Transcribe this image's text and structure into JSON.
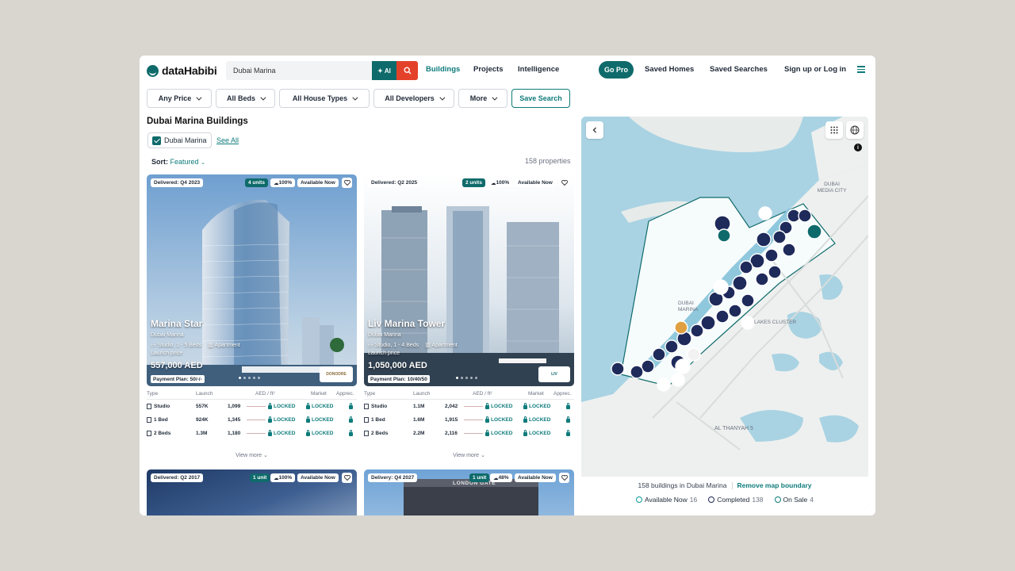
{
  "header": {
    "logo_text": "dataHabibi",
    "search_value": "Dubai Marina",
    "ai_label": "AI",
    "nav": [
      "Buildings",
      "Projects",
      "Intelligence"
    ],
    "go_pro": "Go Pro",
    "saved_homes": "Saved Homes",
    "saved_searches": "Saved Searches",
    "signup": "Sign up or Log in"
  },
  "filters": {
    "price": "Any Price",
    "beds": "All Beds",
    "house_types": "All House Types",
    "developers": "All Developers",
    "more": "More",
    "save_search": "Save Search"
  },
  "list": {
    "title": "Dubai Marina Buildings",
    "chip_label": "Dubai Marina",
    "see_all": "See All",
    "sort_label": "Sort:",
    "sort_value": "Featured",
    "count": "158 properties",
    "table_headers": [
      "Type",
      "Launch",
      "AED / ft²",
      "Market",
      "Apprec."
    ],
    "locked": "LOCKED",
    "view_more": "View more"
  },
  "cards": [
    {
      "delivered": "Delivered: Q4 2023",
      "units": "4 units",
      "percent": "100%",
      "availability": "Available Now",
      "name": "Marina Star",
      "area": "Dubai Marina",
      "beds": "Studio, 1 - 5 Beds",
      "type": "Apartment",
      "launch_label": "Launch price",
      "price": "557,000 AED",
      "plan": "Payment Plan: 50/-/-",
      "developer": "DONODRE",
      "rows": [
        {
          "type": "Studio",
          "launch": "557K",
          "aed": "1,099"
        },
        {
          "type": "1 Bed",
          "launch": "924K",
          "aed": "1,345"
        },
        {
          "type": "2 Beds",
          "launch": "1.3M",
          "aed": "1,180"
        }
      ]
    },
    {
      "delivered": "Delivered: Q2 2025",
      "units": "2 units",
      "percent": "100%",
      "availability": "Available Now",
      "name": "Liv Marina Tower",
      "area": "Dubai Marina",
      "beds": "Studio, 1 - 4 Beds",
      "type": "Apartment",
      "launch_label": "Launch price",
      "price": "1,050,000 AED",
      "plan": "Payment Plan: 10/40/50",
      "developer": "LIV",
      "rows": [
        {
          "type": "Studio",
          "launch": "1.1M",
          "aed": "2,042"
        },
        {
          "type": "1 Bed",
          "launch": "1.6M",
          "aed": "1,915"
        },
        {
          "type": "2 Beds",
          "launch": "2.2M",
          "aed": "2,116"
        }
      ]
    },
    {
      "delivered": "Delivered: Q2 2017",
      "units": "1 unit",
      "percent": "100%",
      "availability": "Available Now"
    },
    {
      "delivered": "Delivery: Q4 2027",
      "units": "1 unit",
      "percent": "48%",
      "availability": "Available Now",
      "sign": "LONDON GATE"
    }
  ],
  "map": {
    "labels": [
      "DUBAI MEDIA CITY",
      "DUBAI MARINA",
      "AL THANYAH 5",
      "LAKES CLUSTER"
    ],
    "footer_count": "158 buildings in Dubai Marina",
    "remove_boundary": "Remove map boundary",
    "legend": [
      {
        "label": "Available Now",
        "count": "16",
        "color": "#0f9b9b"
      },
      {
        "label": "Completed",
        "count": "138",
        "color": "#1e2a5a"
      },
      {
        "label": "On Sale",
        "count": "4",
        "color": "#0f7b7b"
      }
    ]
  }
}
